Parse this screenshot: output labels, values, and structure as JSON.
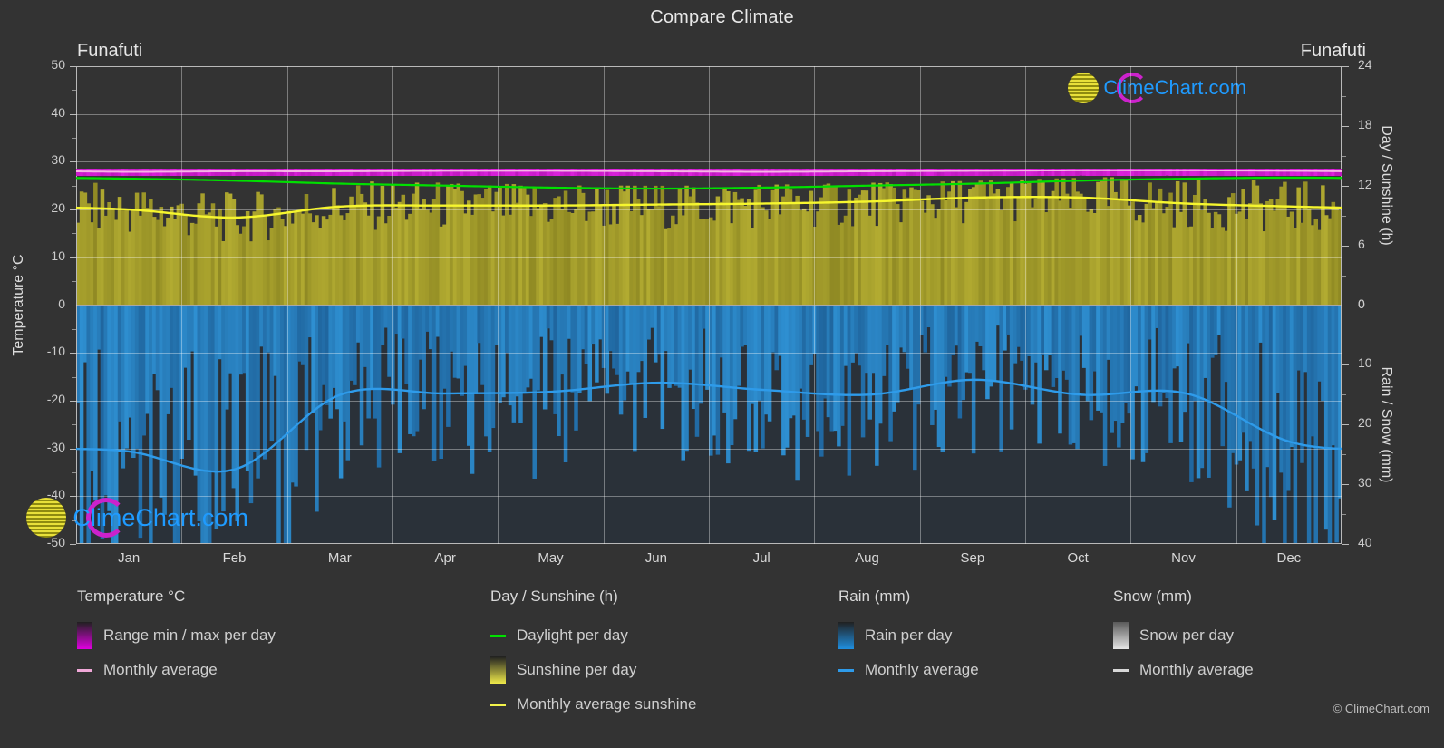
{
  "title": "Compare Climate",
  "stations": {
    "left": "Funafuti",
    "right": "Funafuti"
  },
  "axes": {
    "left_label": "Temperature °C",
    "left_ticks": [
      "50",
      "40",
      "30",
      "20",
      "10",
      "0",
      "-10",
      "-20",
      "-30",
      "-40",
      "-50"
    ],
    "right_top_label": "Day / Sunshine (h)",
    "right_top_ticks": [
      "24",
      "18",
      "12",
      "6",
      "0"
    ],
    "right_bottom_label": "Rain / Snow (mm)",
    "right_bottom_ticks": [
      "0",
      "10",
      "20",
      "30",
      "40"
    ],
    "x_ticks": [
      "Jan",
      "Feb",
      "Mar",
      "Apr",
      "May",
      "Jun",
      "Jul",
      "Aug",
      "Sep",
      "Oct",
      "Nov",
      "Dec"
    ]
  },
  "logo": {
    "text": "ClimeChart.com",
    "arc_color": "#cc22cc",
    "text_color": "#1f9bff"
  },
  "copyright": "© ClimeChart.com",
  "legend": {
    "temperature": {
      "heading": "Temperature °C",
      "items": [
        {
          "label": "Range min / max per day",
          "marker": "box",
          "color": "#e000e0"
        },
        {
          "label": "Monthly average",
          "marker": "line",
          "color": "#f0a8d8"
        }
      ]
    },
    "day_sunshine": {
      "heading": "Day / Sunshine (h)",
      "items": [
        {
          "label": "Daylight per day",
          "marker": "line",
          "color": "#00e000"
        },
        {
          "label": "Sunshine per day",
          "marker": "box",
          "color": "#efe94a"
        },
        {
          "label": "Monthly average sunshine",
          "marker": "line",
          "color": "#f2f24a"
        }
      ]
    },
    "rain": {
      "heading": "Rain (mm)",
      "items": [
        {
          "label": "Rain per day",
          "marker": "box",
          "color": "#1f8fe0"
        },
        {
          "label": "Monthly average",
          "marker": "line",
          "color": "#2e9bea"
        }
      ]
    },
    "snow": {
      "heading": "Snow (mm)",
      "items": [
        {
          "label": "Snow per day",
          "marker": "box",
          "color": "#e6e6e6"
        },
        {
          "label": "Monthly average",
          "marker": "line",
          "color": "#d8d8d8"
        }
      ]
    }
  },
  "chart_data": {
    "type": "area",
    "title": "Compare Climate",
    "subtitle": "Funafuti",
    "xlabel": "",
    "ylabel": "Temperature °C",
    "ylim": [
      -50,
      50
    ],
    "y2_top_label": "Day / Sunshine (h)",
    "y2_top_lim": [
      0,
      24
    ],
    "y2_bottom_label": "Rain / Snow (mm)",
    "y2_bottom_lim": [
      0,
      40
    ],
    "grid": true,
    "legend_position": "below",
    "categories": [
      "Jan",
      "Feb",
      "Mar",
      "Apr",
      "May",
      "Jun",
      "Jul",
      "Aug",
      "Sep",
      "Oct",
      "Nov",
      "Dec"
    ],
    "series": [
      {
        "name": "Temperature monthly average",
        "unit": "°C",
        "color": "#f0a8d8",
        "values": [
          27.9,
          28.0,
          28.0,
          28.1,
          28.1,
          28.0,
          27.9,
          28.0,
          28.1,
          28.2,
          28.2,
          28.1
        ]
      },
      {
        "name": "Temperature range max per day",
        "unit": "°C",
        "color": "#e000e0",
        "values": [
          29.4,
          29.4,
          29.4,
          29.5,
          29.5,
          29.4,
          29.3,
          29.4,
          29.6,
          29.7,
          29.7,
          29.6
        ]
      },
      {
        "name": "Temperature range min per day",
        "unit": "°C",
        "color": "#9a2a9a",
        "values": [
          26.2,
          26.2,
          26.2,
          26.3,
          26.3,
          26.2,
          26.1,
          26.2,
          26.3,
          26.4,
          26.4,
          26.3
        ]
      },
      {
        "name": "Daylight per day",
        "unit": "h",
        "color": "#00e000",
        "values": [
          12.7,
          12.5,
          12.2,
          12.0,
          11.8,
          11.7,
          11.8,
          12.0,
          12.2,
          12.5,
          12.7,
          12.8
        ]
      },
      {
        "name": "Monthly average sunshine",
        "unit": "h",
        "color": "#f2f24a",
        "values": [
          9.6,
          8.8,
          9.9,
          10.0,
          10.0,
          10.1,
          10.2,
          10.4,
          10.8,
          10.8,
          10.2,
          9.9
        ]
      },
      {
        "name": "Rain monthly average",
        "unit": "mm",
        "color": "#2e9bea",
        "values": [
          24.5,
          27.5,
          15.0,
          14.8,
          14.5,
          13.0,
          14.2,
          15.0,
          12.5,
          15.0,
          14.8,
          23.0
        ]
      },
      {
        "name": "Snow monthly average",
        "unit": "mm",
        "color": "#d8d8d8",
        "values": [
          0,
          0,
          0,
          0,
          0,
          0,
          0,
          0,
          0,
          0,
          0,
          0
        ]
      }
    ]
  }
}
